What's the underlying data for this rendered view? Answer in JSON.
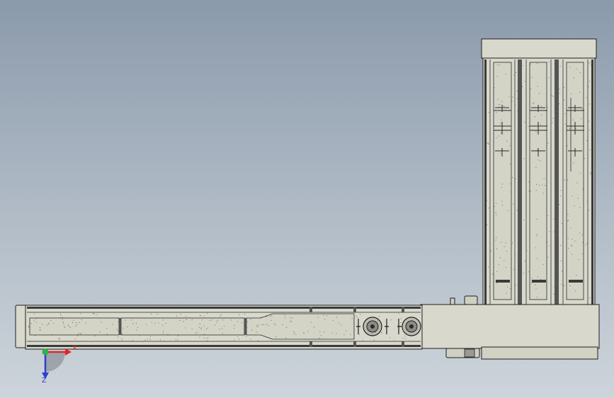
{
  "viewport": {
    "background_top": "#8b9aab",
    "background_bottom": "#cdd4db"
  },
  "model": {
    "part_fill": "#d8d9cc",
    "part_fill_dark": "#c4c5b6",
    "edge_color": "#1e1e1e",
    "rail_color": "#3a3a3a"
  },
  "triad": {
    "x_label": "X",
    "z_label": "Z",
    "x_color": "#e0262b",
    "y_color": "#2ab54a",
    "z_color": "#2d3fcf"
  }
}
